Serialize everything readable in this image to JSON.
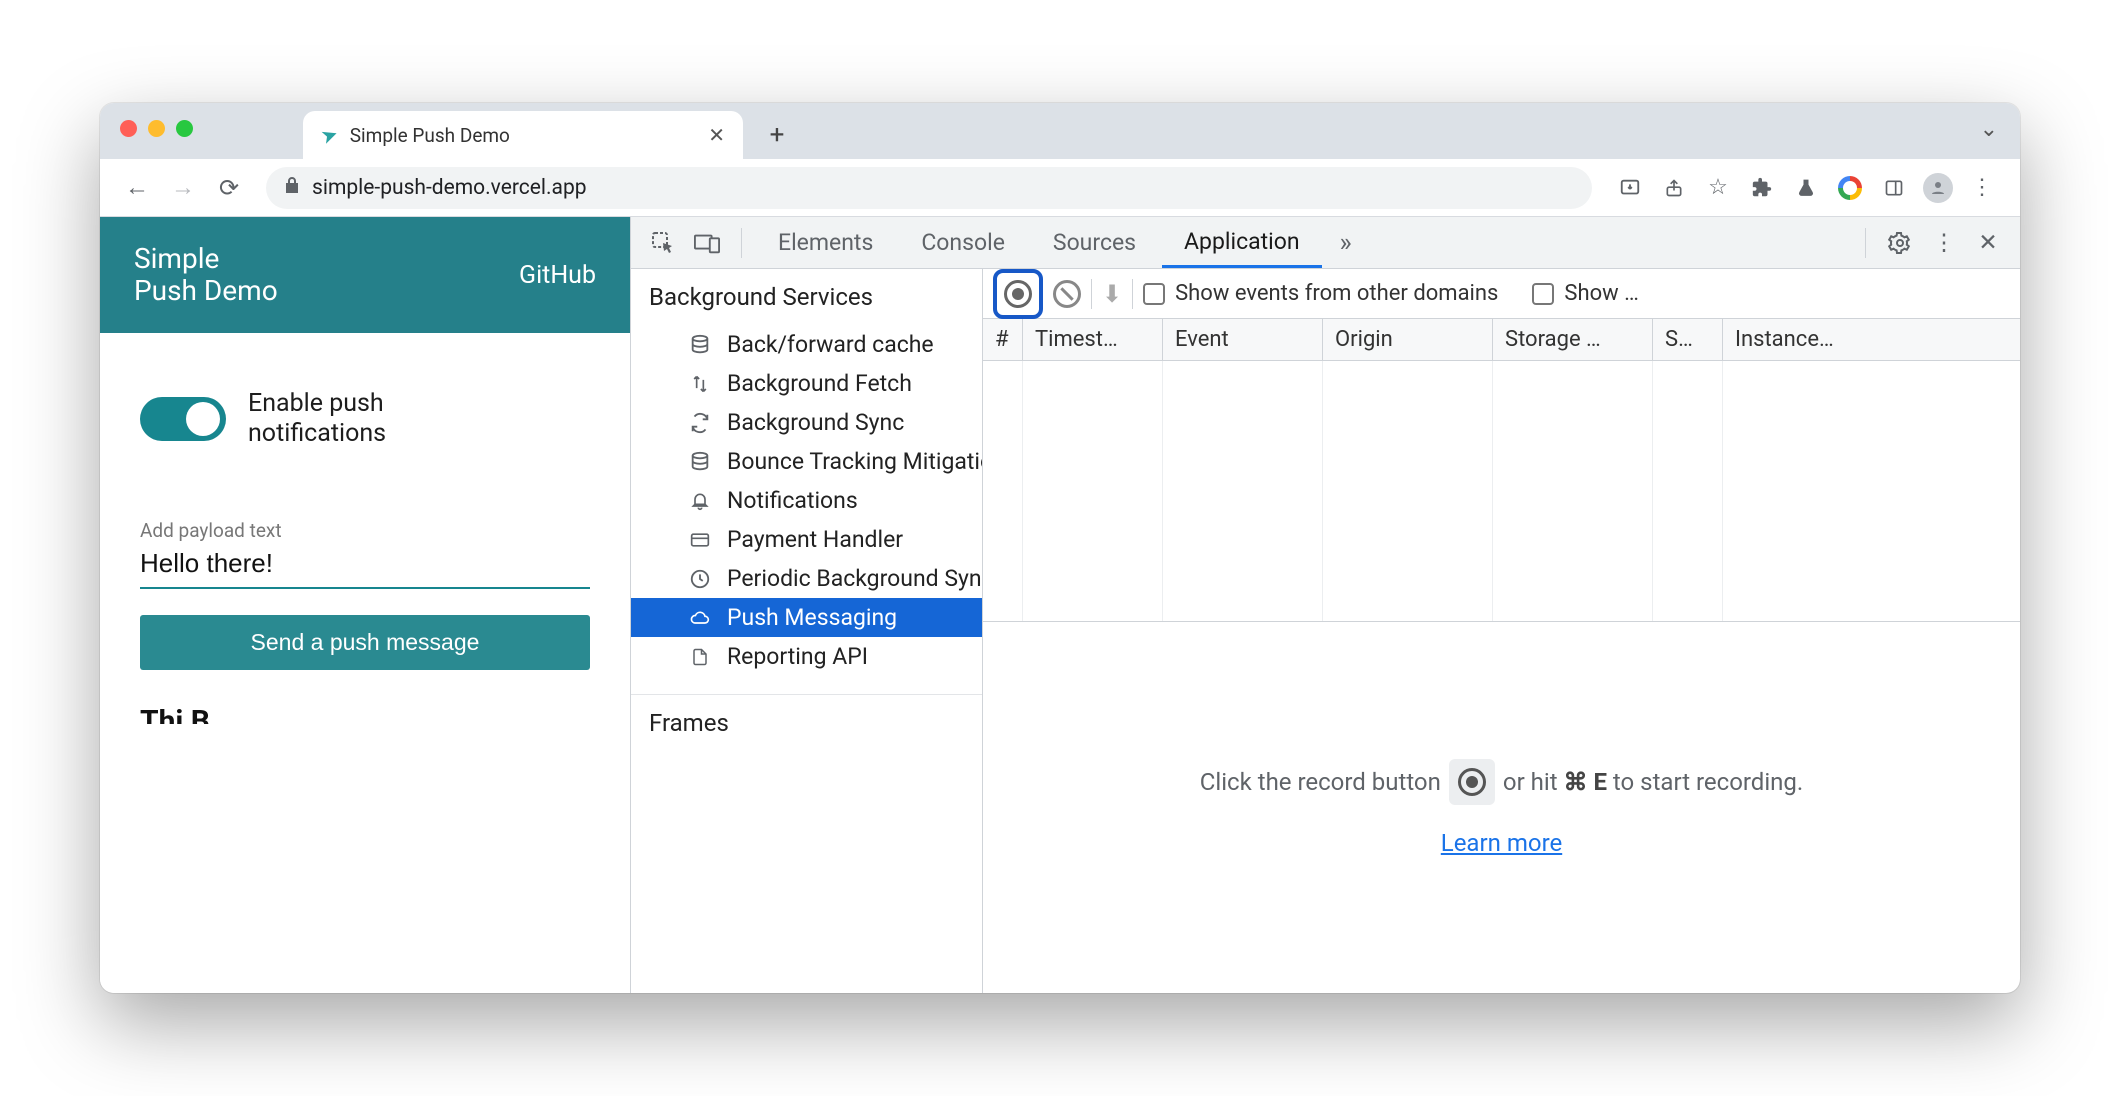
{
  "browser": {
    "tab_title": "Simple Push Demo",
    "url": "simple-push-demo.vercel.app"
  },
  "app": {
    "title_line1": "Simple",
    "title_line2": "Push Demo",
    "header_link": "GitHub",
    "toggle_line1": "Enable push",
    "toggle_line2": "notifications",
    "payload_label": "Add payload text",
    "payload_value": "Hello there!",
    "send_button": "Send a push message",
    "truncated_heading": "Thi  B"
  },
  "devtools": {
    "tabs": {
      "elements": "Elements",
      "console": "Console",
      "sources": "Sources",
      "application": "Application"
    },
    "sidebar": {
      "category": "Background Services",
      "items": [
        "Back/forward cache",
        "Background Fetch",
        "Background Sync",
        "Bounce Tracking Mitigations",
        "Notifications",
        "Payment Handler",
        "Periodic Background Sync",
        "Push Messaging",
        "Reporting API"
      ],
      "category2": "Frames"
    },
    "toolbar": {
      "show_other_domains": "Show events from other domains",
      "show_truncated": "Show …"
    },
    "columns": [
      "#",
      "Timest…",
      "Event",
      "Origin",
      "Storage …",
      "S…",
      "Instance…"
    ],
    "placeholder": {
      "before": "Click the record button",
      "after_pre": "or hit",
      "shortcut_mod": "⌘",
      "shortcut_key": "E",
      "after_post": "to start recording.",
      "learn": "Learn more"
    }
  }
}
